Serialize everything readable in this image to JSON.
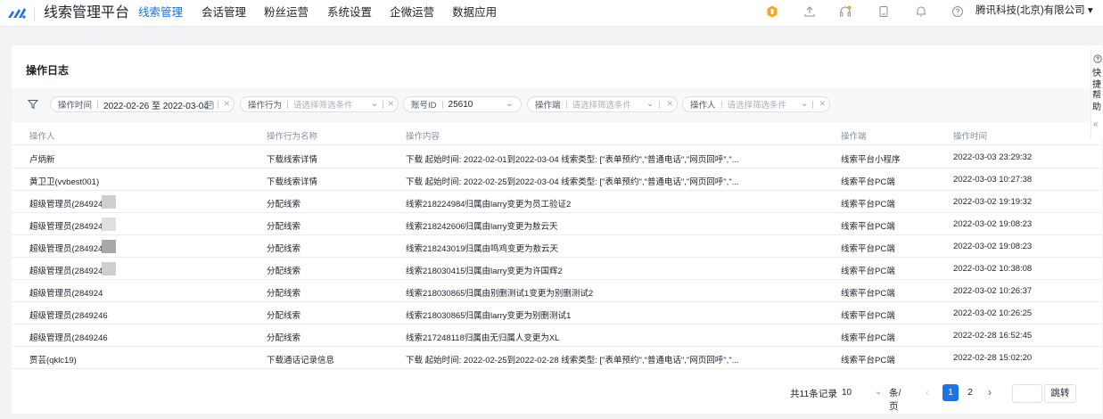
{
  "header": {
    "app_title": "线索管理平台",
    "nav": [
      {
        "label": "线索管理",
        "active": true
      },
      {
        "label": "会话管理",
        "active": false
      },
      {
        "label": "粉丝运营",
        "active": false
      },
      {
        "label": "系统设置",
        "active": false
      },
      {
        "label": "企微运营",
        "active": false
      },
      {
        "label": "数据应用",
        "active": false
      }
    ],
    "company": "腾讯科技(北京)有限公司",
    "company_caret": "▾",
    "tool_icons": [
      "hexagon-badge-icon",
      "upload-icon",
      "headset-icon",
      "document-icon",
      "bell-icon",
      "help-icon"
    ],
    "accent_color": "#1a73e8"
  },
  "page": {
    "title": "操作日志"
  },
  "filters": {
    "time": {
      "label": "操作时间",
      "value": "2022-02-26 至 2022-03-04"
    },
    "action": {
      "label": "操作行为",
      "placeholder": "请选择筛选条件"
    },
    "account": {
      "label": "账号ID",
      "value": "25610"
    },
    "terminal": {
      "label": "操作端",
      "placeholder": "请选择筛选条件"
    },
    "operator": {
      "label": "操作人",
      "placeholder": "请选择筛选条件"
    }
  },
  "table": {
    "columns": [
      "操作人",
      "操作行为名称",
      "操作内容",
      "操作端",
      "操作时间"
    ],
    "rows": [
      [
        "卢炳新",
        "下载线索详情",
        "下载 起始时间: 2022-02-01到2022-03-04 线索类型: [\"表单预约\",\"普通电话\",\"网页回呼\",\"...",
        "线索平台小程序",
        "2022-03-03 23:29:32"
      ],
      [
        "黄卫卫(vvbest001)",
        "下载线索详情",
        "下载 起始时间: 2022-02-25到2022-03-04 线索类型: [\"表单预约\",\"普通电话\",\"网页回呼\",\"...",
        "线索平台PC端",
        "2022-03-03 10:27:38"
      ],
      [
        "超级管理员(2849246",
        "分配线索",
        "线索218224984归属由larry变更为员工验证2",
        "线索平台PC端",
        "2022-03-02 19:19:32"
      ],
      [
        "超级管理员(284924F",
        "分配线索",
        "线索218242606归属由larry变更为敖云天",
        "线索平台PC端",
        "2022-03-02 19:08:23"
      ],
      [
        "超级管理员(284924",
        "分配线索",
        "线索218243019归属由鸣鸡变更为敖云天",
        "线索平台PC端",
        "2022-03-02 19:08:23"
      ],
      [
        "超级管理员(284924(",
        "分配线索",
        "线索218030415归属由larry变更为许国辉2",
        "线索平台PC端",
        "2022-03-02 10:38:08"
      ],
      [
        "超级管理员(284924",
        "分配线索",
        "线索218030865归属由别删测试1变更为别删测试2",
        "线索平台PC端",
        "2022-03-02 10:26:37"
      ],
      [
        "超级管理员(2849246",
        "分配线索",
        "线索218030865归属由larry变更为别删测试1",
        "线索平台PC端",
        "2022-03-02 10:26:25"
      ],
      [
        "超级管理员(2849246",
        "分配线索",
        "线索217248118归属由无归属人变更为XL",
        "线索平台PC端",
        "2022-02-28 16:52:45"
      ],
      [
        "贾芸(qklc19)",
        "下载通话记录信息",
        "下载 起始时间: 2022-02-25到2022-02-28 线索类型: [\"表单预约\",\"普通电话\",\"网页回呼\",\"...",
        "线索平台PC端",
        "2022-02-28 15:02:20"
      ]
    ]
  },
  "pagination": {
    "total_text": "共11条记录",
    "page_size": "10",
    "page_size_unit": "条/页",
    "pages": [
      "1",
      "2"
    ],
    "current_page": "1",
    "jump_label": "跳转"
  },
  "help": {
    "text": "快捷帮助"
  }
}
